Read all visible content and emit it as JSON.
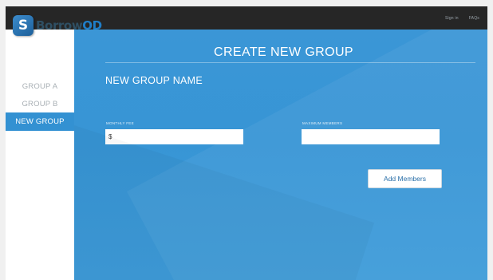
{
  "brand": {
    "name_main": "Borrow",
    "name_accent": "OD",
    "badge_letter": "S"
  },
  "topnav": {
    "sign_in": "Sign in",
    "faqs": "FAQs"
  },
  "sidebar": {
    "items": [
      {
        "label": "GROUP A",
        "active": false
      },
      {
        "label": "GROUP B",
        "active": false
      },
      {
        "label": "NEW GROUP",
        "active": true
      }
    ]
  },
  "main": {
    "title": "CREATE NEW GROUP",
    "section_title": "NEW GROUP NAME",
    "monthly_fee": {
      "label": "MONTHLY FEE",
      "value": "$"
    },
    "maximum_members": {
      "label": "MAXIMUM MEMBERS",
      "value": ""
    },
    "add_members_label": "Add Members"
  },
  "colors": {
    "accent": "#3b96d6",
    "topbar": "#262626",
    "active_item": "#3391d2",
    "brand_dark": "#2f4f63",
    "brand_accent": "#1f7ec8"
  }
}
